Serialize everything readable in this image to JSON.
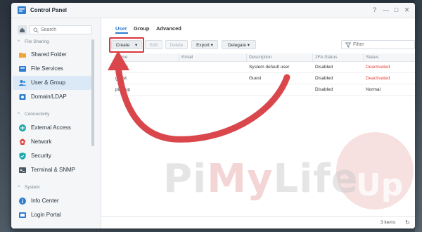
{
  "app": {
    "title": "Control Panel"
  },
  "window_controls": {
    "help": "?",
    "minimize": "—",
    "maximize": "□",
    "close": "✕"
  },
  "sidebar": {
    "search_placeholder": "Search",
    "sections": [
      {
        "title": "File Sharing",
        "items": [
          {
            "label": "Shared Folder",
            "icon": "shared-folder-icon"
          },
          {
            "label": "File Services",
            "icon": "file-services-icon"
          },
          {
            "label": "User & Group",
            "icon": "user-group-icon",
            "active": true
          },
          {
            "label": "Domain/LDAP",
            "icon": "domain-ldap-icon"
          }
        ]
      },
      {
        "title": "Connectivity",
        "items": [
          {
            "label": "External Access",
            "icon": "external-access-icon"
          },
          {
            "label": "Network",
            "icon": "network-icon"
          },
          {
            "label": "Security",
            "icon": "security-icon"
          },
          {
            "label": "Terminal & SNMP",
            "icon": "terminal-icon"
          }
        ]
      },
      {
        "title": "System",
        "items": [
          {
            "label": "Info Center",
            "icon": "info-center-icon"
          },
          {
            "label": "Login Portal",
            "icon": "login-portal-icon"
          }
        ]
      }
    ]
  },
  "tabs": [
    {
      "label": "User",
      "active": true
    },
    {
      "label": "Group"
    },
    {
      "label": "Advanced"
    }
  ],
  "toolbar": {
    "create": "Create",
    "create_caret": "▾",
    "edit": "Edit",
    "delete": "Delete",
    "export": "Export",
    "delegate": "Delegate",
    "dropdown_caret": "▾",
    "filter_placeholder": "Filter"
  },
  "table": {
    "columns": [
      "Name",
      "Email",
      "Description",
      "2FA Status",
      "Status"
    ],
    "rows": [
      {
        "name": "admin",
        "email": "",
        "description": "System default user",
        "twofa": "Disabled",
        "status": "Deactivated",
        "status_color": "#e0443e"
      },
      {
        "name": "guest",
        "email": "",
        "description": "Guest",
        "twofa": "Disabled",
        "status": "Deactivated",
        "status_color": "#e0443e"
      },
      {
        "name": "pimyup",
        "email": "",
        "description": "",
        "twofa": "Disabled",
        "status": "Normal",
        "status_color": "#333333"
      }
    ]
  },
  "footer": {
    "count": "3 items",
    "refresh": "↻"
  },
  "watermark": {
    "pi": "Pi",
    "my": "My",
    "life": "Life",
    "up": "Up"
  },
  "colors": {
    "accent": "#2f7dd1",
    "highlight_red": "#d9363e",
    "deactivated": "#e0443e"
  }
}
